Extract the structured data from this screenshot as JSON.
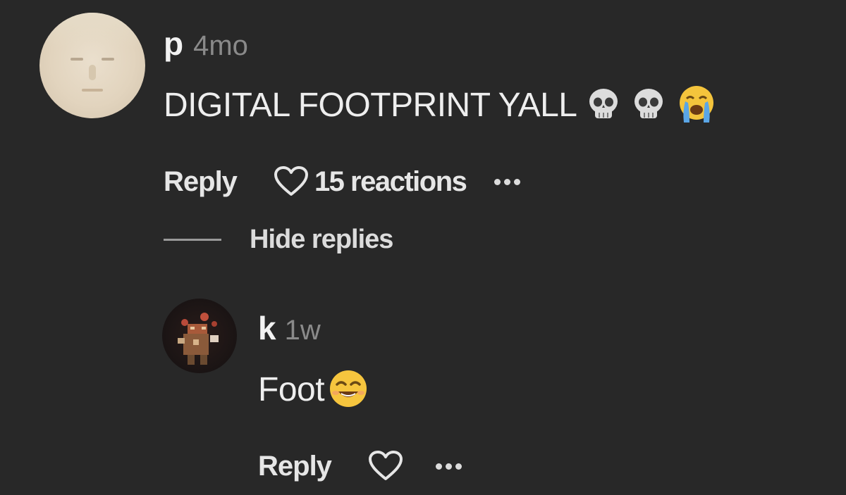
{
  "comment": {
    "username": "p",
    "timestamp": "4mo",
    "text": "DIGITAL FOOTPRINT YALL",
    "emojis": [
      "skull",
      "skull",
      "loudly-crying-face"
    ],
    "actions": {
      "reply_label": "Reply",
      "reactions_label": "15 reactions",
      "more_icon": "ellipsis-icon",
      "heart_icon": "heart-outline-icon"
    },
    "hide_replies_label": "Hide replies"
  },
  "reply": {
    "username": "k",
    "timestamp": "1w",
    "text": "Foot",
    "emojis": [
      "smiling-face-with-closed-eyes"
    ],
    "actions": {
      "reply_label": "Reply",
      "more_icon": "ellipsis-icon",
      "heart_icon": "heart-outline-icon"
    }
  },
  "colors": {
    "background": "#282828",
    "text_primary": "#eeeeee",
    "text_secondary": "#8a8a8a"
  }
}
